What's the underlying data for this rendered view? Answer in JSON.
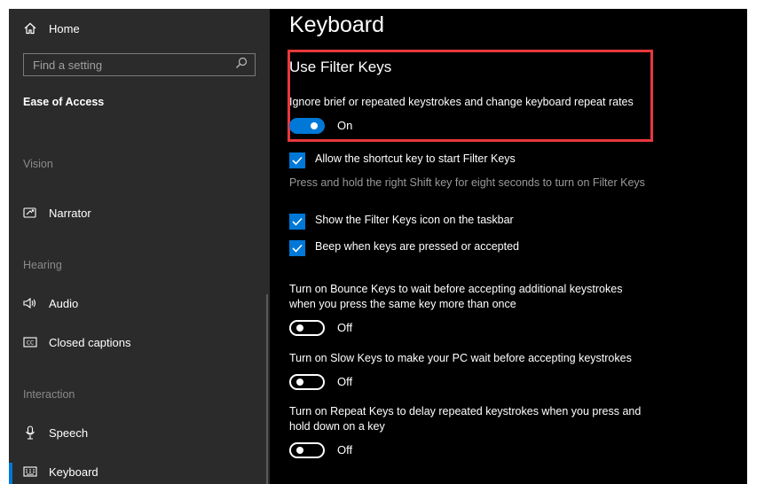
{
  "sidebar": {
    "home_label": "Home",
    "search_placeholder": "Find a setting",
    "category": "Ease of Access",
    "sections": {
      "vision": "Vision",
      "hearing": "Hearing",
      "interaction": "Interaction"
    },
    "items": {
      "narrator": "Narrator",
      "audio": "Audio",
      "closed_captions": "Closed captions",
      "speech": "Speech",
      "keyboard": "Keyboard"
    },
    "selected": "Keyboard"
  },
  "main": {
    "title": "Keyboard",
    "filter_keys": {
      "title": "Use Filter Keys",
      "description": "Ignore brief or repeated keystrokes and change keyboard repeat rates",
      "toggle_state": "On"
    },
    "allow_shortcut": {
      "label": "Allow the shortcut key to start Filter Keys",
      "checked": true,
      "hint": "Press and hold the right Shift key for eight seconds to turn on Filter Keys"
    },
    "show_icon": {
      "label": "Show the Filter Keys icon on the taskbar",
      "checked": true
    },
    "beep": {
      "label": "Beep when keys are pressed or accepted",
      "checked": true
    },
    "bounce_keys": {
      "line1": "Turn on Bounce Keys to wait before accepting additional keystrokes",
      "line2": "when you press the same key more than once",
      "toggle_state": "Off"
    },
    "slow_keys": {
      "line1": "Turn on Slow Keys to make your PC wait before accepting keystrokes",
      "toggle_state": "Off"
    },
    "repeat_keys": {
      "line1": "Turn on Repeat Keys to delay repeated keystrokes when you press and",
      "line2": "hold down on a key",
      "toggle_state": "Off"
    }
  },
  "colors": {
    "accent": "#0078d7",
    "highlight_border": "#e8383d",
    "sidebar_bg": "#2b2b2b",
    "main_bg": "#000000"
  }
}
